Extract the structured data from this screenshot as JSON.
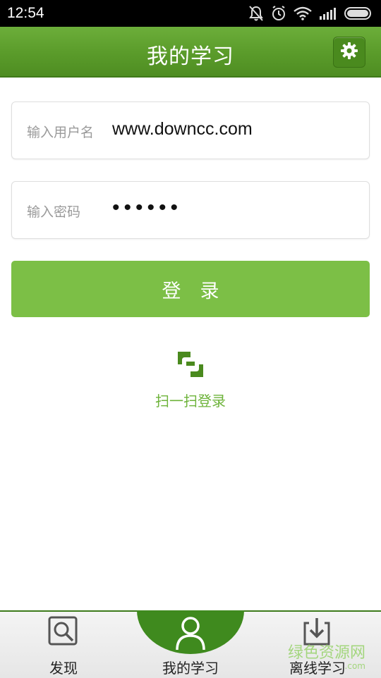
{
  "status_bar": {
    "time": "12:54"
  },
  "header": {
    "title": "我的学习"
  },
  "form": {
    "username_label": "输入用户名",
    "username_value": "www.downcc.com",
    "password_label": "输入密码",
    "password_value": "••••••",
    "login_label": "登　录"
  },
  "scan": {
    "label": "扫一扫登录"
  },
  "bottom_nav": {
    "items": [
      {
        "label": "发现",
        "icon": "search-icon"
      },
      {
        "label": "我的学习",
        "icon": "user-icon",
        "active": true
      },
      {
        "label": "离线学习",
        "icon": "download-icon"
      }
    ]
  },
  "watermark": {
    "text": "绿色资源网",
    "sub": ".com"
  },
  "colors": {
    "brand_green": "#5a9b2a",
    "button_green": "#7cbf46",
    "accent_text": "#6db33a"
  }
}
